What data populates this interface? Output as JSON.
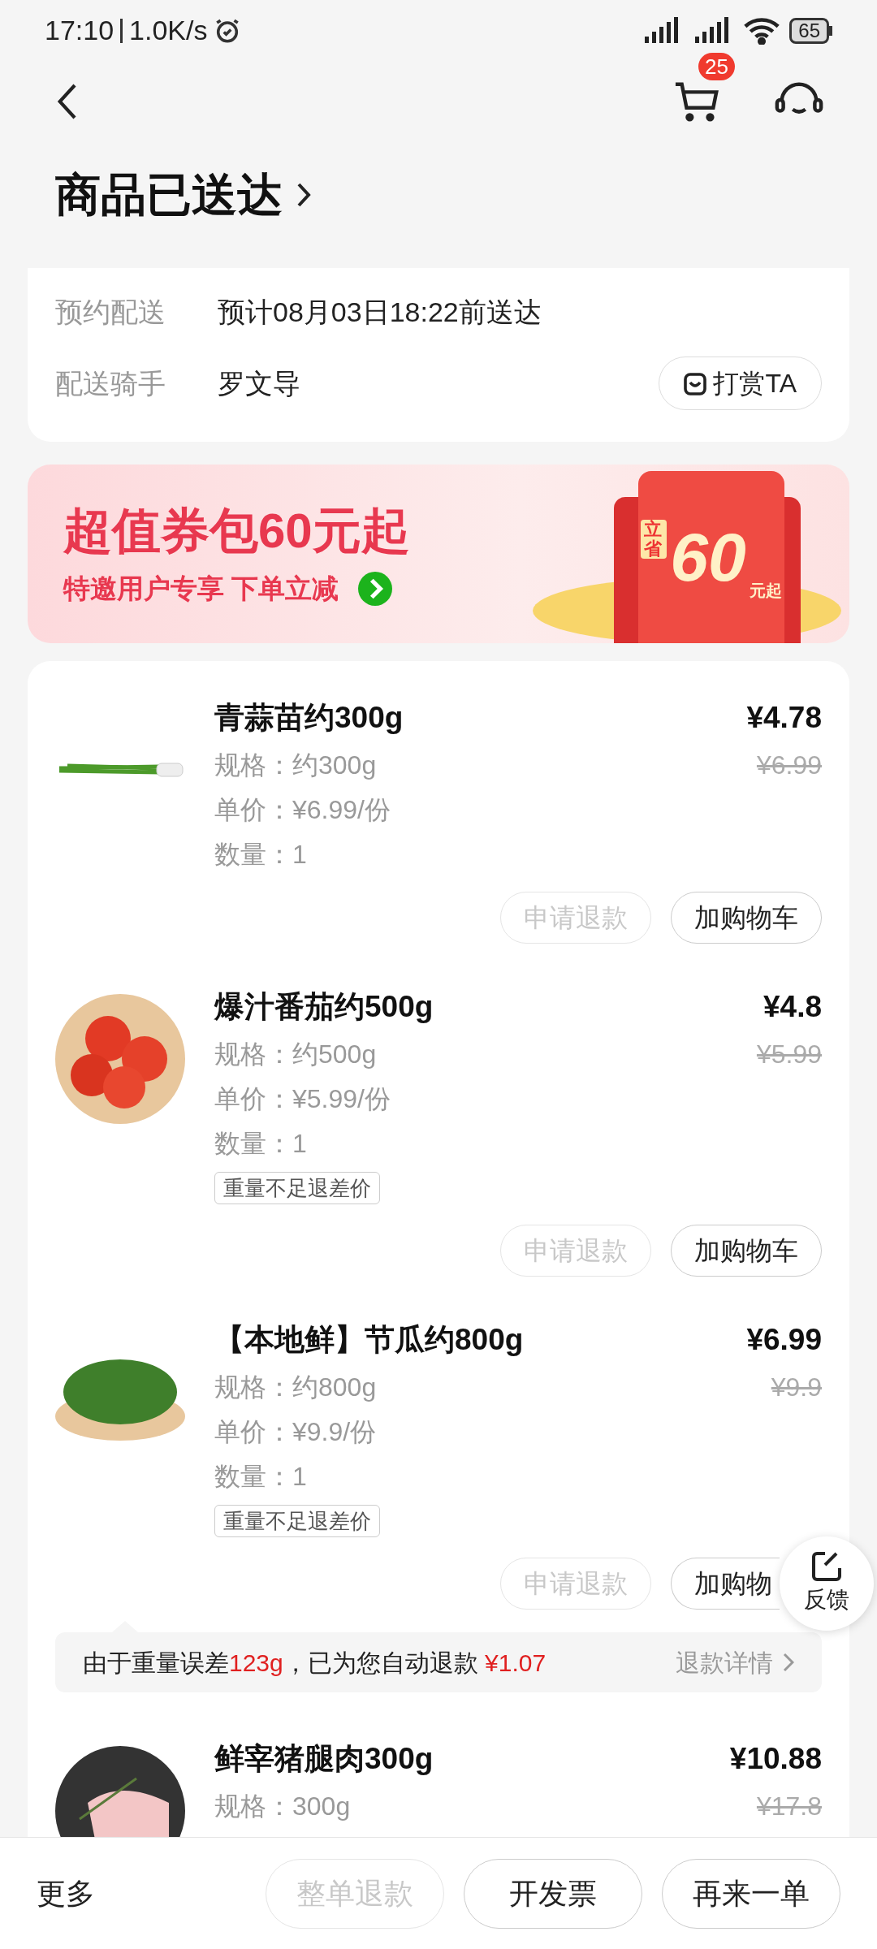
{
  "status_bar": {
    "time": "17:10",
    "speed": "1.0K/s",
    "battery": "65"
  },
  "nav": {
    "cart_badge": "25"
  },
  "title": "商品已送达",
  "delivery": [
    {
      "label": "预约配送",
      "value": "预计08月03日18:22前送达"
    },
    {
      "label": "配送骑手",
      "value": "罗文导",
      "action": "打赏TA"
    }
  ],
  "banner": {
    "title": "超值券包60元起",
    "subtitle": "特邀用户专享 下单立减",
    "ticket_top": "立省",
    "ticket_amount": "60",
    "ticket_unit": "元起"
  },
  "items": [
    {
      "name": "青蒜苗约300g",
      "price": "¥4.78",
      "original_price": "¥6.99",
      "spec": "规格：约300g",
      "unit_price": "单价：¥6.99/份",
      "quantity": "数量：1",
      "buttons": [
        {
          "label": "申请退款",
          "disabled": true
        },
        {
          "label": "加购物车",
          "disabled": false
        }
      ]
    },
    {
      "name": "爆汁番茄约500g",
      "price": "¥4.8",
      "original_price": "¥5.99",
      "spec": "规格：约500g",
      "unit_price": "单价：¥5.99/份",
      "quantity": "数量：1",
      "tag": "重量不足退差价",
      "buttons": [
        {
          "label": "申请退款",
          "disabled": true
        },
        {
          "label": "加购物车",
          "disabled": false
        }
      ]
    },
    {
      "name": "【本地鲜】节瓜约800g",
      "price": "¥6.99",
      "original_price": "¥9.9",
      "spec": "规格：约800g",
      "unit_price": "单价：¥9.9/份",
      "quantity": "数量：1",
      "tag": "重量不足退差价",
      "buttons": [
        {
          "label": "申请退款",
          "disabled": true
        },
        {
          "label": "加购物",
          "disabled": false,
          "partly_covered": true
        }
      ],
      "refund_note": {
        "parts": [
          {
            "text": "由于重量误差",
            "highlight": false
          },
          {
            "text": "123g",
            "highlight": true
          },
          {
            "text": "，已为您自动退款 ",
            "highlight": false
          },
          {
            "text": "¥1.07",
            "highlight": true
          }
        ],
        "link": "退款详情"
      }
    },
    {
      "name": "鲜宰猪腿肉300g",
      "price": "¥10.88",
      "original_price": "¥17.8",
      "spec": "规格：300g"
    }
  ],
  "feedback": "反馈",
  "bottom_bar": {
    "more": "更多",
    "buttons": [
      {
        "label": "整单退款",
        "disabled": true
      },
      {
        "label": "开发票",
        "disabled": false
      },
      {
        "label": "再来一单",
        "disabled": false
      }
    ]
  }
}
